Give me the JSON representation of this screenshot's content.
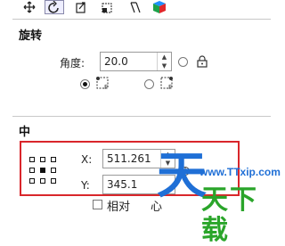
{
  "toolbar": {
    "buttons": [
      {
        "name": "move-icon"
      },
      {
        "name": "rotate-icon"
      },
      {
        "name": "scale-icon"
      },
      {
        "name": "size-icon"
      },
      {
        "name": "skew-icon"
      },
      {
        "name": "color-cube-icon"
      }
    ]
  },
  "rotation": {
    "heading": "旋转",
    "angle_label": "角度:",
    "angle_value": "20.0"
  },
  "center": {
    "heading": "中",
    "x_label": "X:",
    "x_value": "511.261",
    "y_label": "Y:",
    "y_value": "345.1",
    "relative_label": "相对",
    "relative_suffix": "心"
  },
  "watermark": {
    "big_char": "天",
    "url": "www.TTxip.com",
    "name": "天下载"
  },
  "colors": {
    "highlight_border": "#d9262b",
    "watermark_blue": "#1f6fd6",
    "watermark_green": "#2aa52a"
  }
}
